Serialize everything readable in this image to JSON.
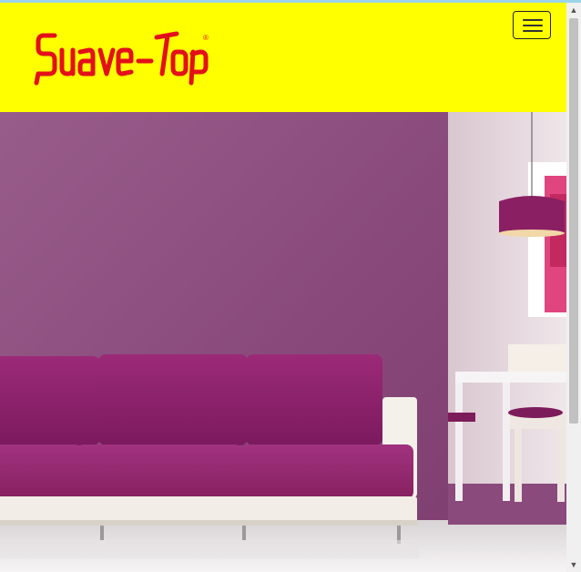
{
  "brand": {
    "name": "Suave-Top",
    "registered_mark": "®",
    "logo_color": "#e3101a",
    "header_bg": "#ffff00"
  },
  "nav": {
    "toggle_icon": "hamburger-menu-icon",
    "toggle_label": ""
  },
  "hero": {
    "image": "living-room-with-purple-sofa",
    "wall_color": "#8e4f7e",
    "sofa_color": "#8a1f6a"
  },
  "scrollbar": {
    "up_icon": "▲",
    "down_icon": "▼"
  }
}
